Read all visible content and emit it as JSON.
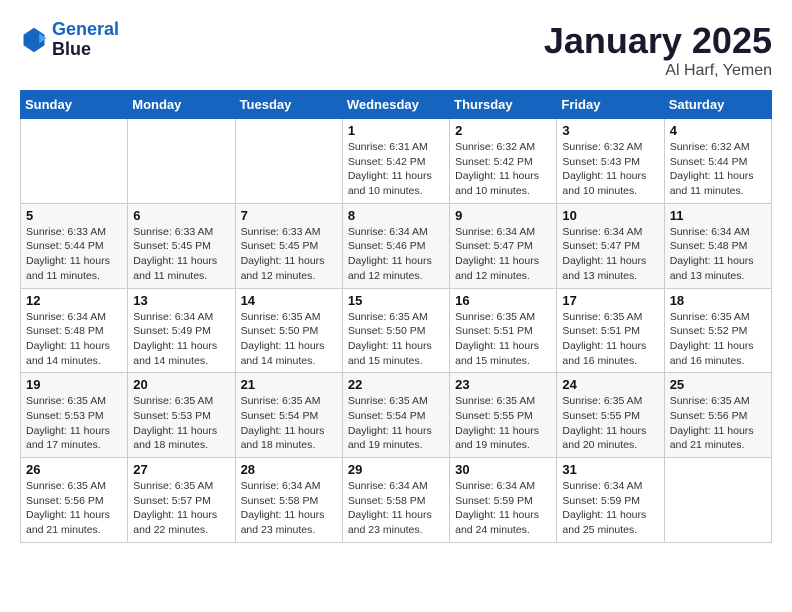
{
  "header": {
    "logo_line1": "General",
    "logo_line2": "Blue",
    "month_title": "January 2025",
    "location": "Al Harf, Yemen"
  },
  "weekdays": [
    "Sunday",
    "Monday",
    "Tuesday",
    "Wednesday",
    "Thursday",
    "Friday",
    "Saturday"
  ],
  "weeks": [
    [
      {
        "day": "",
        "info": ""
      },
      {
        "day": "",
        "info": ""
      },
      {
        "day": "",
        "info": ""
      },
      {
        "day": "1",
        "info": "Sunrise: 6:31 AM\nSunset: 5:42 PM\nDaylight: 11 hours\nand 10 minutes."
      },
      {
        "day": "2",
        "info": "Sunrise: 6:32 AM\nSunset: 5:42 PM\nDaylight: 11 hours\nand 10 minutes."
      },
      {
        "day": "3",
        "info": "Sunrise: 6:32 AM\nSunset: 5:43 PM\nDaylight: 11 hours\nand 10 minutes."
      },
      {
        "day": "4",
        "info": "Sunrise: 6:32 AM\nSunset: 5:44 PM\nDaylight: 11 hours\nand 11 minutes."
      }
    ],
    [
      {
        "day": "5",
        "info": "Sunrise: 6:33 AM\nSunset: 5:44 PM\nDaylight: 11 hours\nand 11 minutes."
      },
      {
        "day": "6",
        "info": "Sunrise: 6:33 AM\nSunset: 5:45 PM\nDaylight: 11 hours\nand 11 minutes."
      },
      {
        "day": "7",
        "info": "Sunrise: 6:33 AM\nSunset: 5:45 PM\nDaylight: 11 hours\nand 12 minutes."
      },
      {
        "day": "8",
        "info": "Sunrise: 6:34 AM\nSunset: 5:46 PM\nDaylight: 11 hours\nand 12 minutes."
      },
      {
        "day": "9",
        "info": "Sunrise: 6:34 AM\nSunset: 5:47 PM\nDaylight: 11 hours\nand 12 minutes."
      },
      {
        "day": "10",
        "info": "Sunrise: 6:34 AM\nSunset: 5:47 PM\nDaylight: 11 hours\nand 13 minutes."
      },
      {
        "day": "11",
        "info": "Sunrise: 6:34 AM\nSunset: 5:48 PM\nDaylight: 11 hours\nand 13 minutes."
      }
    ],
    [
      {
        "day": "12",
        "info": "Sunrise: 6:34 AM\nSunset: 5:48 PM\nDaylight: 11 hours\nand 14 minutes."
      },
      {
        "day": "13",
        "info": "Sunrise: 6:34 AM\nSunset: 5:49 PM\nDaylight: 11 hours\nand 14 minutes."
      },
      {
        "day": "14",
        "info": "Sunrise: 6:35 AM\nSunset: 5:50 PM\nDaylight: 11 hours\nand 14 minutes."
      },
      {
        "day": "15",
        "info": "Sunrise: 6:35 AM\nSunset: 5:50 PM\nDaylight: 11 hours\nand 15 minutes."
      },
      {
        "day": "16",
        "info": "Sunrise: 6:35 AM\nSunset: 5:51 PM\nDaylight: 11 hours\nand 15 minutes."
      },
      {
        "day": "17",
        "info": "Sunrise: 6:35 AM\nSunset: 5:51 PM\nDaylight: 11 hours\nand 16 minutes."
      },
      {
        "day": "18",
        "info": "Sunrise: 6:35 AM\nSunset: 5:52 PM\nDaylight: 11 hours\nand 16 minutes."
      }
    ],
    [
      {
        "day": "19",
        "info": "Sunrise: 6:35 AM\nSunset: 5:53 PM\nDaylight: 11 hours\nand 17 minutes."
      },
      {
        "day": "20",
        "info": "Sunrise: 6:35 AM\nSunset: 5:53 PM\nDaylight: 11 hours\nand 18 minutes."
      },
      {
        "day": "21",
        "info": "Sunrise: 6:35 AM\nSunset: 5:54 PM\nDaylight: 11 hours\nand 18 minutes."
      },
      {
        "day": "22",
        "info": "Sunrise: 6:35 AM\nSunset: 5:54 PM\nDaylight: 11 hours\nand 19 minutes."
      },
      {
        "day": "23",
        "info": "Sunrise: 6:35 AM\nSunset: 5:55 PM\nDaylight: 11 hours\nand 19 minutes."
      },
      {
        "day": "24",
        "info": "Sunrise: 6:35 AM\nSunset: 5:55 PM\nDaylight: 11 hours\nand 20 minutes."
      },
      {
        "day": "25",
        "info": "Sunrise: 6:35 AM\nSunset: 5:56 PM\nDaylight: 11 hours\nand 21 minutes."
      }
    ],
    [
      {
        "day": "26",
        "info": "Sunrise: 6:35 AM\nSunset: 5:56 PM\nDaylight: 11 hours\nand 21 minutes."
      },
      {
        "day": "27",
        "info": "Sunrise: 6:35 AM\nSunset: 5:57 PM\nDaylight: 11 hours\nand 22 minutes."
      },
      {
        "day": "28",
        "info": "Sunrise: 6:34 AM\nSunset: 5:58 PM\nDaylight: 11 hours\nand 23 minutes."
      },
      {
        "day": "29",
        "info": "Sunrise: 6:34 AM\nSunset: 5:58 PM\nDaylight: 11 hours\nand 23 minutes."
      },
      {
        "day": "30",
        "info": "Sunrise: 6:34 AM\nSunset: 5:59 PM\nDaylight: 11 hours\nand 24 minutes."
      },
      {
        "day": "31",
        "info": "Sunrise: 6:34 AM\nSunset: 5:59 PM\nDaylight: 11 hours\nand 25 minutes."
      },
      {
        "day": "",
        "info": ""
      }
    ]
  ]
}
